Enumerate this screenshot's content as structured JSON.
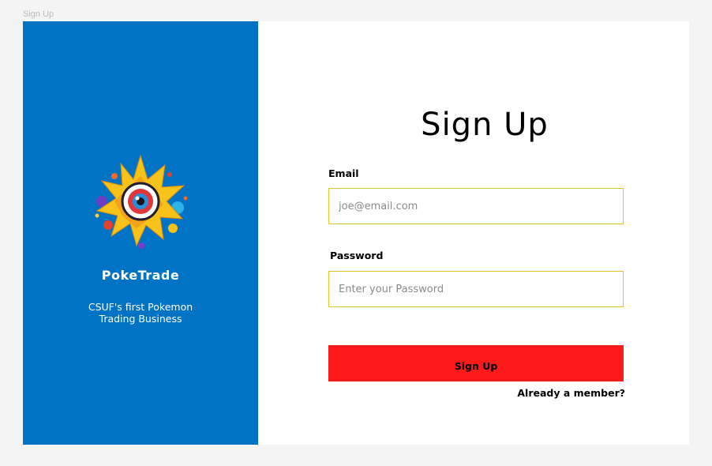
{
  "frame": {
    "label": "Sign Up"
  },
  "brand": {
    "name": "PokeTrade",
    "tagline": "CSUF's first Pokemon Trading Business",
    "panel_color": "#0073c4",
    "logo_icon": "poke-eye-starburst-icon"
  },
  "form": {
    "title": "Sign Up",
    "email": {
      "label": "Email",
      "placeholder": "joe@email.com",
      "value": ""
    },
    "password": {
      "label": "Password",
      "placeholder": "Enter your Password",
      "value": ""
    },
    "submit_label": "Sign Up",
    "submit_color": "#ff1a1a",
    "input_border_color": "#e2c62c",
    "member_link": "Already a member?"
  }
}
